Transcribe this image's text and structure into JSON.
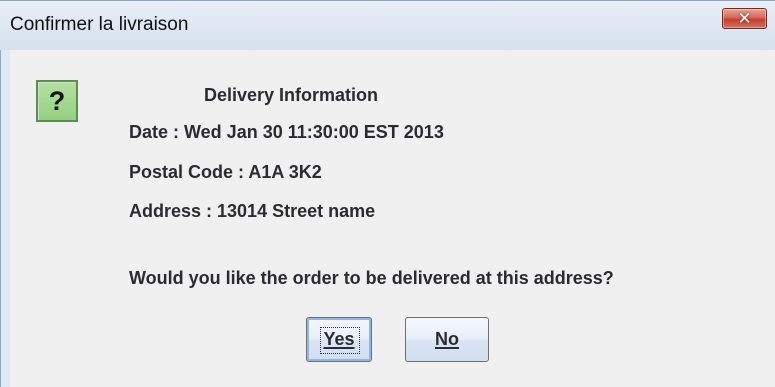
{
  "window": {
    "title": "Confirmer la livraison",
    "close_symbol": "✕"
  },
  "dialog": {
    "icon": "question-icon",
    "icon_symbol": "?",
    "heading": "Delivery Information",
    "date_line": "Date : Wed Jan 30 11:30:00 EST 2013",
    "postal_line": "Postal Code : A1A 3K2",
    "address_line": "Address : 13014 Street name",
    "question": "Would you like the order to be delivered at this address?"
  },
  "buttons": {
    "yes_label": "Yes",
    "no_label": "No"
  },
  "colors": {
    "title_bar": "#dfe8f3",
    "content_bg": "#f0f0f0",
    "close_button": "#c2402f",
    "icon_bg": "#93cf80"
  }
}
